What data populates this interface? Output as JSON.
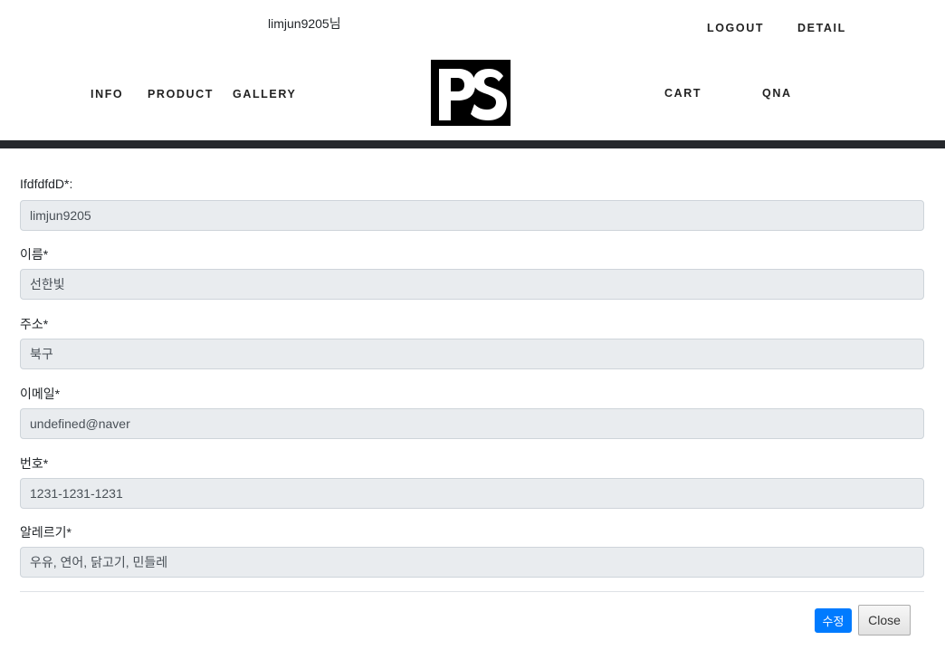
{
  "header": {
    "greeting": "limjun9205님",
    "top_links": {
      "logout": "LOGOUT",
      "detail": "DETAIL"
    },
    "nav_left": [
      "INFO",
      "PRODUCT",
      "GALLERY"
    ],
    "nav_right": [
      "CART",
      "QNA"
    ],
    "logo_text": "PS"
  },
  "form": {
    "fields": [
      {
        "label": "IfdfdfdD*:",
        "value": "limjun9205"
      },
      {
        "label": "이름*",
        "value": "선한빛"
      },
      {
        "label": "주소*",
        "value": "북구"
      },
      {
        "label": "이메일*",
        "value": "undefined@naver"
      },
      {
        "label": "번호*",
        "value": "1231-1231-1231"
      },
      {
        "label": "알레르기*",
        "value": "우유, 연어, 닭고기, 민들레"
      }
    ]
  },
  "footer": {
    "edit_label": "수정",
    "close_label": "Close"
  },
  "colors": {
    "header_bar": "#25282c",
    "input_bg": "#e9ecef",
    "primary": "#007bff"
  }
}
